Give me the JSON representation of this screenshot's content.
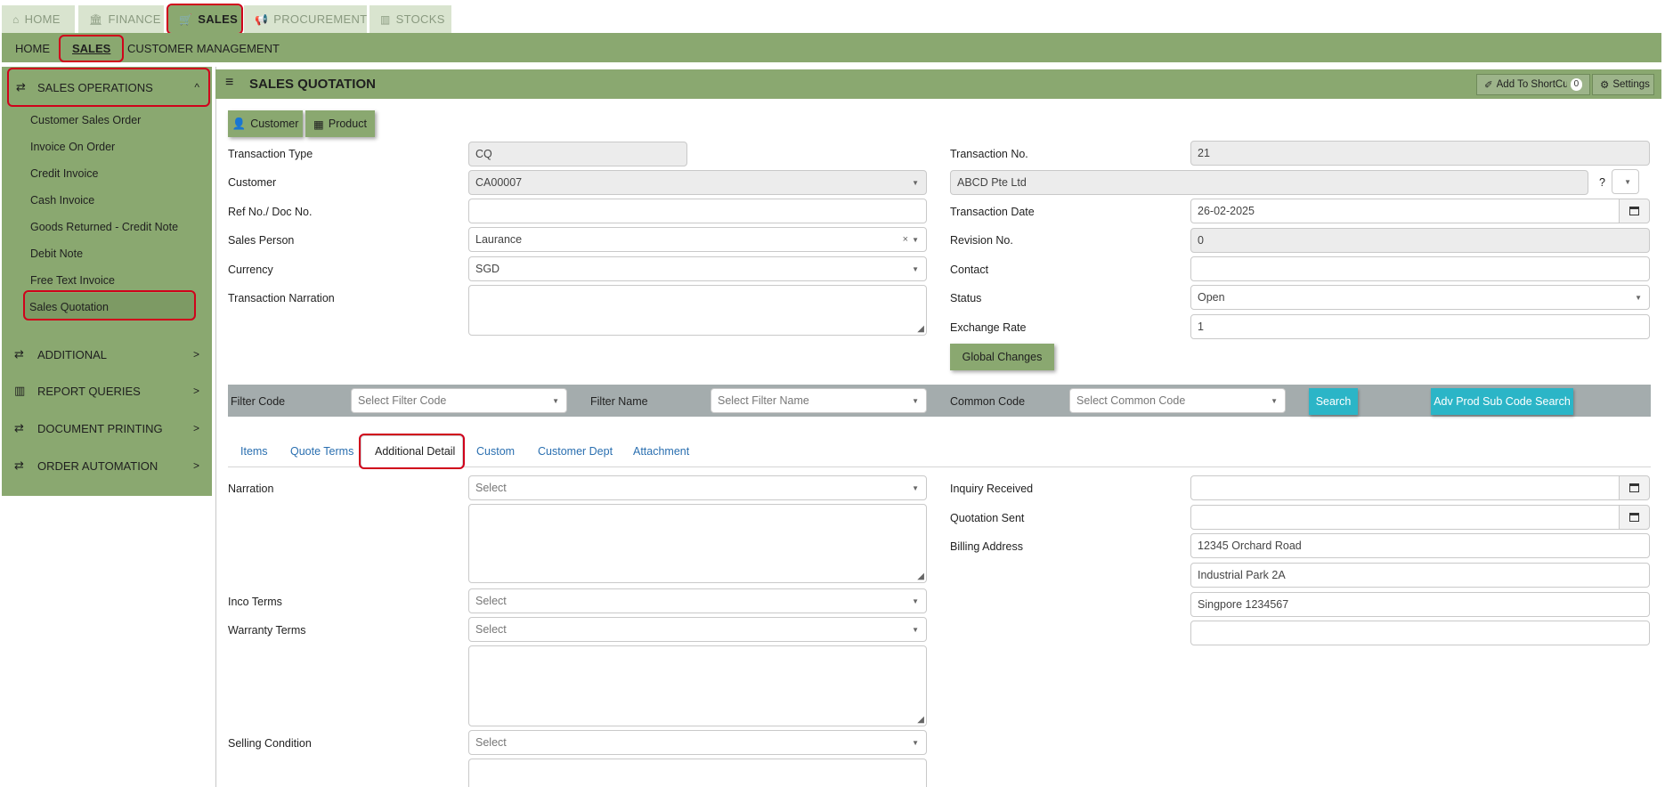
{
  "modules": [
    {
      "label": "HOME",
      "icon": "home-icon"
    },
    {
      "label": "FINANCE",
      "icon": "bank-icon"
    },
    {
      "label": "SALES",
      "icon": "cart-icon"
    },
    {
      "label": "PROCUREMENT",
      "icon": "bullhorn-icon"
    },
    {
      "label": "STOCKS",
      "icon": "bar-chart-icon"
    }
  ],
  "subnav": [
    "HOME",
    "SALES",
    "CUSTOMER MANAGEMENT"
  ],
  "sidebar": {
    "section": "SALES OPERATIONS",
    "items": [
      "Customer Sales Order",
      "Invoice On Order",
      "Credit Invoice",
      "Cash Invoice",
      "Goods Returned - Credit Note",
      "Debit Note",
      "Free Text Invoice",
      "Sales Quotation"
    ],
    "groups": [
      "ADDITIONAL",
      "REPORT QUERIES",
      "DOCUMENT PRINTING",
      "ORDER AUTOMATION"
    ]
  },
  "page": {
    "title": "SALES QUOTATION",
    "shortcut_label": "Add To ShortCut",
    "shortcut_count": "0",
    "settings_label": "Settings"
  },
  "buttons": {
    "customer": "Customer",
    "product": "Product",
    "global_changes": "Global Changes"
  },
  "form": {
    "transaction_type": {
      "label": "Transaction Type",
      "value": "CQ"
    },
    "customer": {
      "label": "Customer",
      "value": "CA00007",
      "name": "ABCD Pte Ltd",
      "help": "?"
    },
    "ref_no": {
      "label": "Ref No./ Doc No.",
      "value": ""
    },
    "sales_person": {
      "label": "Sales Person",
      "value": "Laurance",
      "clear": "×"
    },
    "currency": {
      "label": "Currency",
      "value": "SGD"
    },
    "narration": {
      "label": "Transaction Narration",
      "value": ""
    },
    "transaction_no": {
      "label": "Transaction No.",
      "value": "21"
    },
    "transaction_date": {
      "label": "Transaction Date",
      "value": "26-02-2025"
    },
    "revision_no": {
      "label": "Revision No.",
      "value": "0"
    },
    "contact": {
      "label": "Contact",
      "value": ""
    },
    "status": {
      "label": "Status",
      "value": "Open"
    },
    "exchange_rate": {
      "label": "Exchange Rate",
      "value": "1"
    }
  },
  "filter": {
    "code_label": "Filter Code",
    "code_placeholder": "Select Filter Code",
    "name_label": "Filter Name",
    "name_placeholder": "Select Filter Name",
    "common_label": "Common Code",
    "common_placeholder": "Select Common Code",
    "search": "Search",
    "adv_search": "Adv Prod Sub Code Search"
  },
  "tabs": [
    "Items",
    "Quote Terms",
    "Additional Detail",
    "Custom",
    "Customer Dept",
    "Attachment"
  ],
  "detail": {
    "narration_label": "Narration",
    "inco_label": "Inco Terms",
    "warranty_label": "Warranty Terms",
    "selling_label": "Selling Condition",
    "select_placeholder": "Select",
    "inquiry_label": "Inquiry Received",
    "quotation_sent_label": "Quotation Sent",
    "billing_label": "Billing Address",
    "billing_lines": [
      "12345 Orchard Road",
      "Industrial Park 2A",
      "Singpore 1234567",
      ""
    ]
  },
  "colors": {
    "green": "#8aa870",
    "cyan": "#2bb5c7",
    "highlight": "#d0021b"
  }
}
